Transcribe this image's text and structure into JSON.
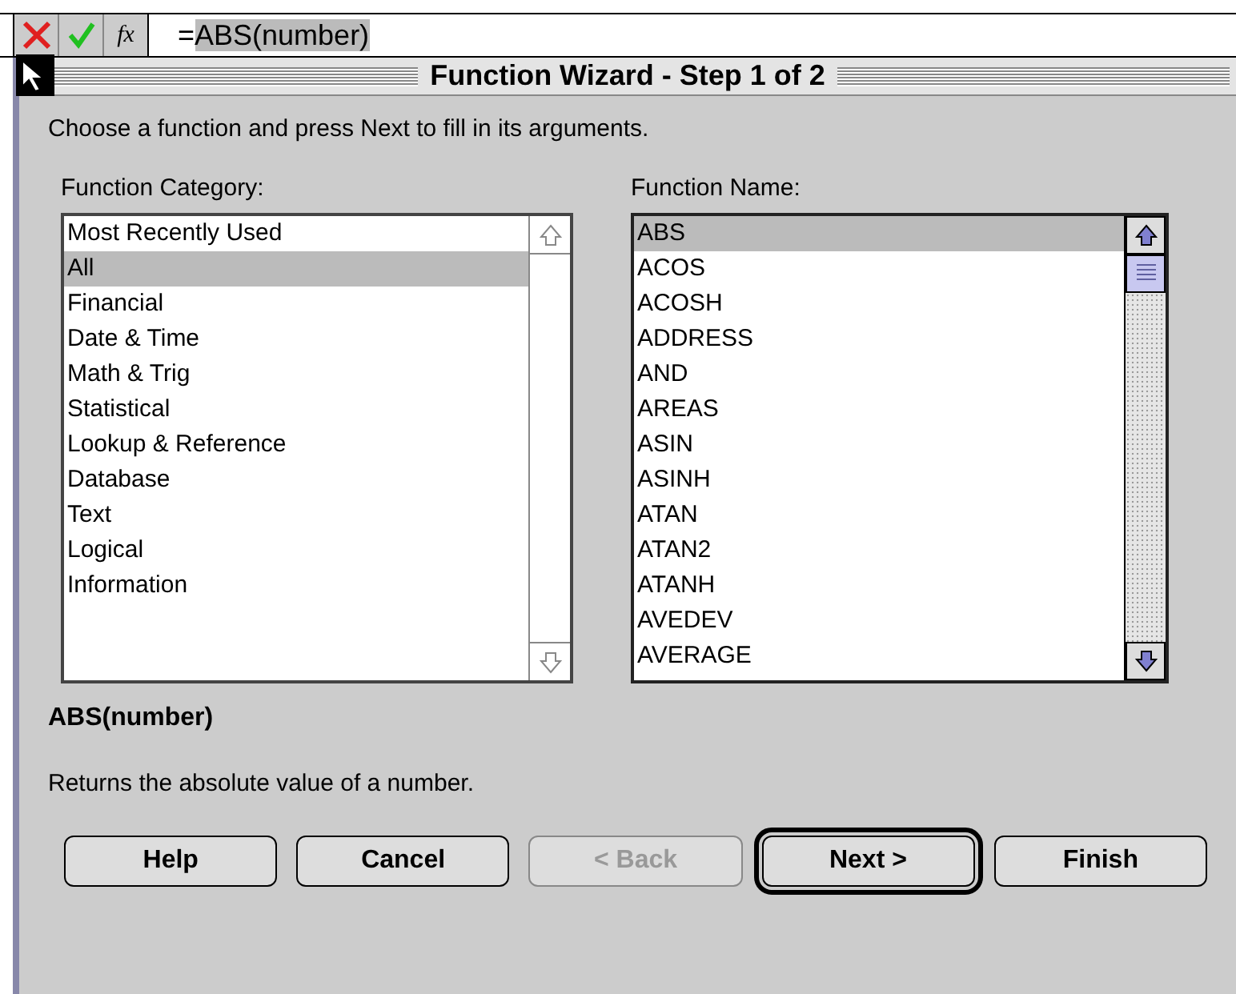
{
  "formula_bar": {
    "fx_label": "fx",
    "prefix": "=",
    "selection": "ABS(number)"
  },
  "window": {
    "title": "Function Wizard - Step 1 of 2"
  },
  "instruction": "Choose a function and press Next to fill in its arguments.",
  "category_list": {
    "label": "Function Category:",
    "items": [
      {
        "label": "Most Recently Used",
        "selected": false
      },
      {
        "label": "All",
        "selected": true
      },
      {
        "label": "Financial",
        "selected": false
      },
      {
        "label": "Date & Time",
        "selected": false
      },
      {
        "label": "Math & Trig",
        "selected": false
      },
      {
        "label": "Statistical",
        "selected": false
      },
      {
        "label": "Lookup & Reference",
        "selected": false
      },
      {
        "label": "Database",
        "selected": false
      },
      {
        "label": "Text",
        "selected": false
      },
      {
        "label": "Logical",
        "selected": false
      },
      {
        "label": "Information",
        "selected": false
      }
    ]
  },
  "name_list": {
    "label": "Function Name:",
    "items": [
      {
        "label": "ABS",
        "selected": true
      },
      {
        "label": "ACOS",
        "selected": false
      },
      {
        "label": "ACOSH",
        "selected": false
      },
      {
        "label": "ADDRESS",
        "selected": false
      },
      {
        "label": "AND",
        "selected": false
      },
      {
        "label": "AREAS",
        "selected": false
      },
      {
        "label": "ASIN",
        "selected": false
      },
      {
        "label": "ASINH",
        "selected": false
      },
      {
        "label": "ATAN",
        "selected": false
      },
      {
        "label": "ATAN2",
        "selected": false
      },
      {
        "label": "ATANH",
        "selected": false
      },
      {
        "label": "AVEDEV",
        "selected": false
      },
      {
        "label": "AVERAGE",
        "selected": false
      }
    ]
  },
  "signature": "ABS(number)",
  "description": "Returns the absolute value of a number.",
  "buttons": [
    {
      "label": "Help",
      "disabled": false,
      "default": false
    },
    {
      "label": "Cancel",
      "disabled": false,
      "default": false
    },
    {
      "label": "< Back",
      "disabled": true,
      "default": false
    },
    {
      "label": "Next >",
      "disabled": false,
      "default": true
    },
    {
      "label": "Finish",
      "disabled": false,
      "default": false
    }
  ]
}
